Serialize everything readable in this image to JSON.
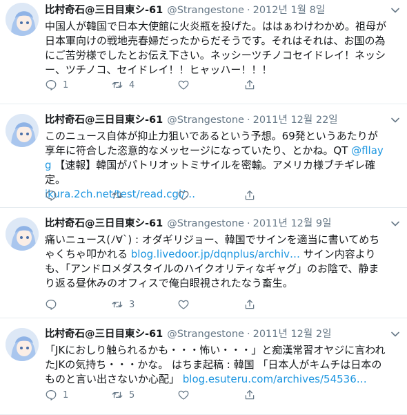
{
  "colors": {
    "link": "#1b95e0",
    "muted": "#657786",
    "divider": "#e6ecf0"
  },
  "icons": {
    "reply": "reply-icon",
    "retweet": "retweet-icon",
    "like": "heart-icon",
    "share": "share-icon",
    "caret": "chevron-down-icon"
  },
  "tweets": [
    {
      "name": "比村奇石@三日目東シ-61",
      "handle": "@Strangestone",
      "sep": "·",
      "date": "2012년 1월 8일",
      "text": "中国人が韓国で日本大使館に火炎瓶を投げた。ははぁわけわかめ。祖母が日本軍向けの戦地売春婦だったからだそうです。それはそれは、お国の為にご苦労様でしたとお伝え下さい。ネッシーツチノコセイドレイ！ネッシー、ツチノコ、セイドレイ！！ヒャッハー！！！",
      "reply_count": "1",
      "retweet_count": "4",
      "like_count": ""
    },
    {
      "name": "比村奇石@三日目東シ-61",
      "handle": "@Strangestone",
      "sep": "·",
      "date": "2011년 12월 22일",
      "text_a": "このニュース自体が抑止力狙いであるという予想。69発というあたりが享年に符合した恣意的なメッセージになっていたり、とかね。QT ",
      "link_a": "@fllayg",
      "text_b": " 【速報】韓国がパトリオットミサイルを密輸。アメリカ様ブチギレ確定。",
      "link_b": "ikura.2ch.net/test/read.cgi/…",
      "reply_count": "",
      "retweet_count": "",
      "like_count": ""
    },
    {
      "name": "比村奇石@三日目東シ-61",
      "handle": "@Strangestone",
      "sep": "·",
      "date": "2011년 12월 9일",
      "text_a": "痛いニュース(ﾉ∀`) : オダギリジョー、韓国でサインを適当に書いてめちゃくちゃ叩かれる ",
      "link_a": "blog.livedoor.jp/dqnplus/archiv…",
      "text_b": " サイン内容よりも、「アンドロメダスタイルのハイクオリティなギャグ」のお陰で、静まり返る昼休みのオフィスで俺白眼視されたなう畜生。",
      "reply_count": "",
      "retweet_count": "3",
      "like_count": ""
    },
    {
      "name": "比村奇石@三日目東シ-61",
      "handle": "@Strangestone",
      "sep": "·",
      "date": "2011년 12월 2일",
      "text_a": "「JKにおしり触られるかも・・・怖い・・・」と痴漢常習オヤジに言われたJKの気持ち・・・かな。 はちま起稿 : 韓国 「日本人がキムチは日本のものと言い出さないか心配」 ",
      "link_a": "blog.esuteru.com/archives/54536…",
      "reply_count": "1",
      "retweet_count": "5",
      "like_count": ""
    }
  ]
}
